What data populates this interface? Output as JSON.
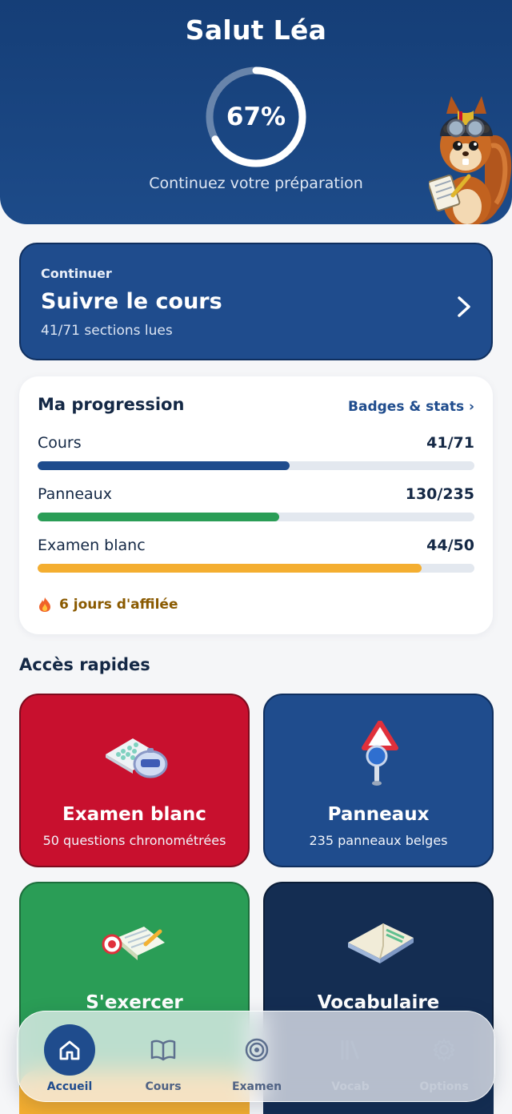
{
  "header": {
    "greeting": "Salut Léa",
    "progress_percent_label": "67%",
    "progress_fraction": 0.67,
    "subtitle": "Continuez votre préparation"
  },
  "continue_card": {
    "kicker": "Continuer",
    "title": "Suivre le cours",
    "subtitle": "41/71 sections lues"
  },
  "progress": {
    "title": "Ma progression",
    "link": "Badges & stats ›",
    "rows": [
      {
        "label": "Cours",
        "value": "41/71",
        "fraction": 0.577,
        "color": "#1f4c8d"
      },
      {
        "label": "Panneaux",
        "value": "130/235",
        "fraction": 0.553,
        "color": "#2a9d56"
      },
      {
        "label": "Examen blanc",
        "value": "44/50",
        "fraction": 0.88,
        "color": "#f4ae30"
      }
    ],
    "streak": "6 jours d'affilée"
  },
  "quick_access": {
    "title": "Accès rapides",
    "tiles": [
      {
        "title": "Examen blanc",
        "subtitle": "50 questions chronométrées",
        "icon": "calculator-stopwatch-icon",
        "color": "#c8102e"
      },
      {
        "title": "Panneaux",
        "subtitle": "235 panneaux belges",
        "icon": "road-sign-magnifier-icon",
        "color": "#1f4c8d"
      },
      {
        "title": "S'exercer",
        "subtitle": "",
        "icon": "notebook-target-icon",
        "color": "#2a9d56"
      },
      {
        "title": "Vocabulaire",
        "subtitle": "",
        "icon": "open-book-icon",
        "color": "#142d52"
      }
    ]
  },
  "tabbar": {
    "items": [
      {
        "label": "Accueil",
        "icon": "home-icon",
        "active": true
      },
      {
        "label": "Cours",
        "icon": "book-icon",
        "active": false
      },
      {
        "label": "Examen",
        "icon": "target-icon",
        "active": false
      },
      {
        "label": "Vocab",
        "icon": "library-icon",
        "active": false
      },
      {
        "label": "Options",
        "icon": "gear-icon",
        "active": false
      }
    ]
  }
}
